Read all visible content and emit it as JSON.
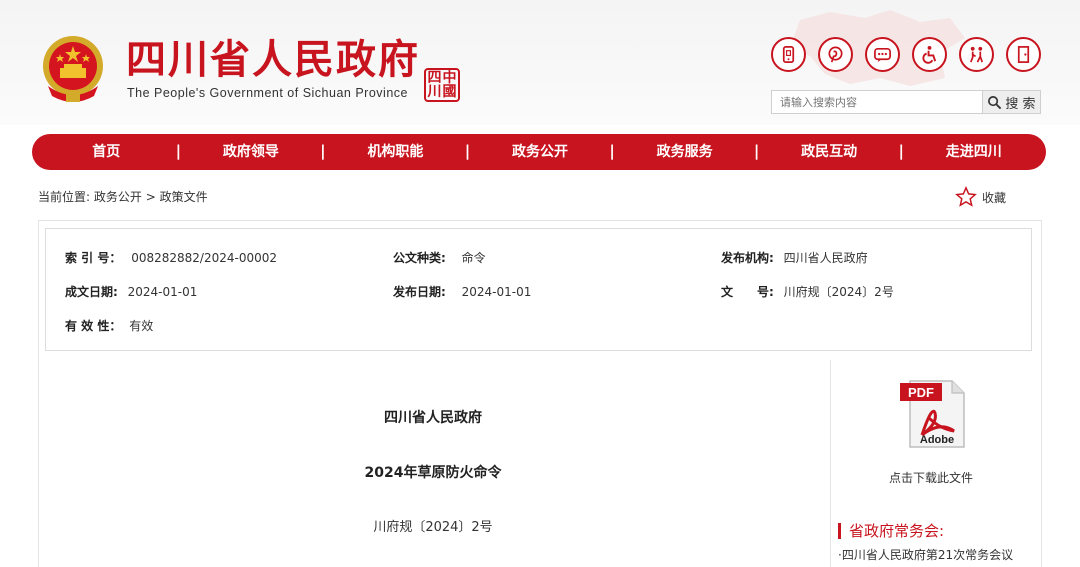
{
  "header": {
    "title_cn": "四川省人民政府",
    "title_en": "The People's Government of Sichuan Province",
    "seal_chars": [
      "四",
      "中",
      "川",
      "國"
    ]
  },
  "toolbar": {
    "icons": [
      "mobile-icon",
      "weibo-icon",
      "wechat-icon",
      "accessibility-icon",
      "elderly-care-icon",
      "exit-icon"
    ]
  },
  "search": {
    "placeholder": "请输入搜索内容",
    "button_label": "搜 索"
  },
  "nav": {
    "items": [
      "首页",
      "政府领导",
      "机构职能",
      "政务公开",
      "政务服务",
      "政民互动",
      "走进四川"
    ]
  },
  "breadcrumb": {
    "prefix": "当前位置:",
    "level1": "政务公开",
    "separator": ">",
    "level2": "政策文件"
  },
  "favorite": {
    "label": "收藏"
  },
  "info": {
    "index_label": "索 引 号：",
    "index_value": "008282882/2024-00002",
    "type_label": "公文种类:",
    "type_value": "命令",
    "org_label": "发布机构:",
    "org_value": "四川省人民政府",
    "created_label": "成文日期:",
    "created_value": "2024-01-01",
    "published_label": "发布日期:",
    "published_value": "2024-01-01",
    "docno_label": "文　　号:",
    "docno_value": "川府规〔2024〕2号",
    "validity_label": "有 效 性：",
    "validity_value": "有效"
  },
  "document": {
    "issuer": "四川省人民政府",
    "title": "2024年草原防火命令",
    "number": "川府规〔2024〕2号"
  },
  "sidebar": {
    "pdf_text": "PDF",
    "adobe_text": "Adobe",
    "download_label": "点击下载此文件",
    "section_title": "省政府常务会:",
    "link": "·四川省人民政府第21次常务会议"
  },
  "colors": {
    "brand_red": "#c8141e"
  }
}
